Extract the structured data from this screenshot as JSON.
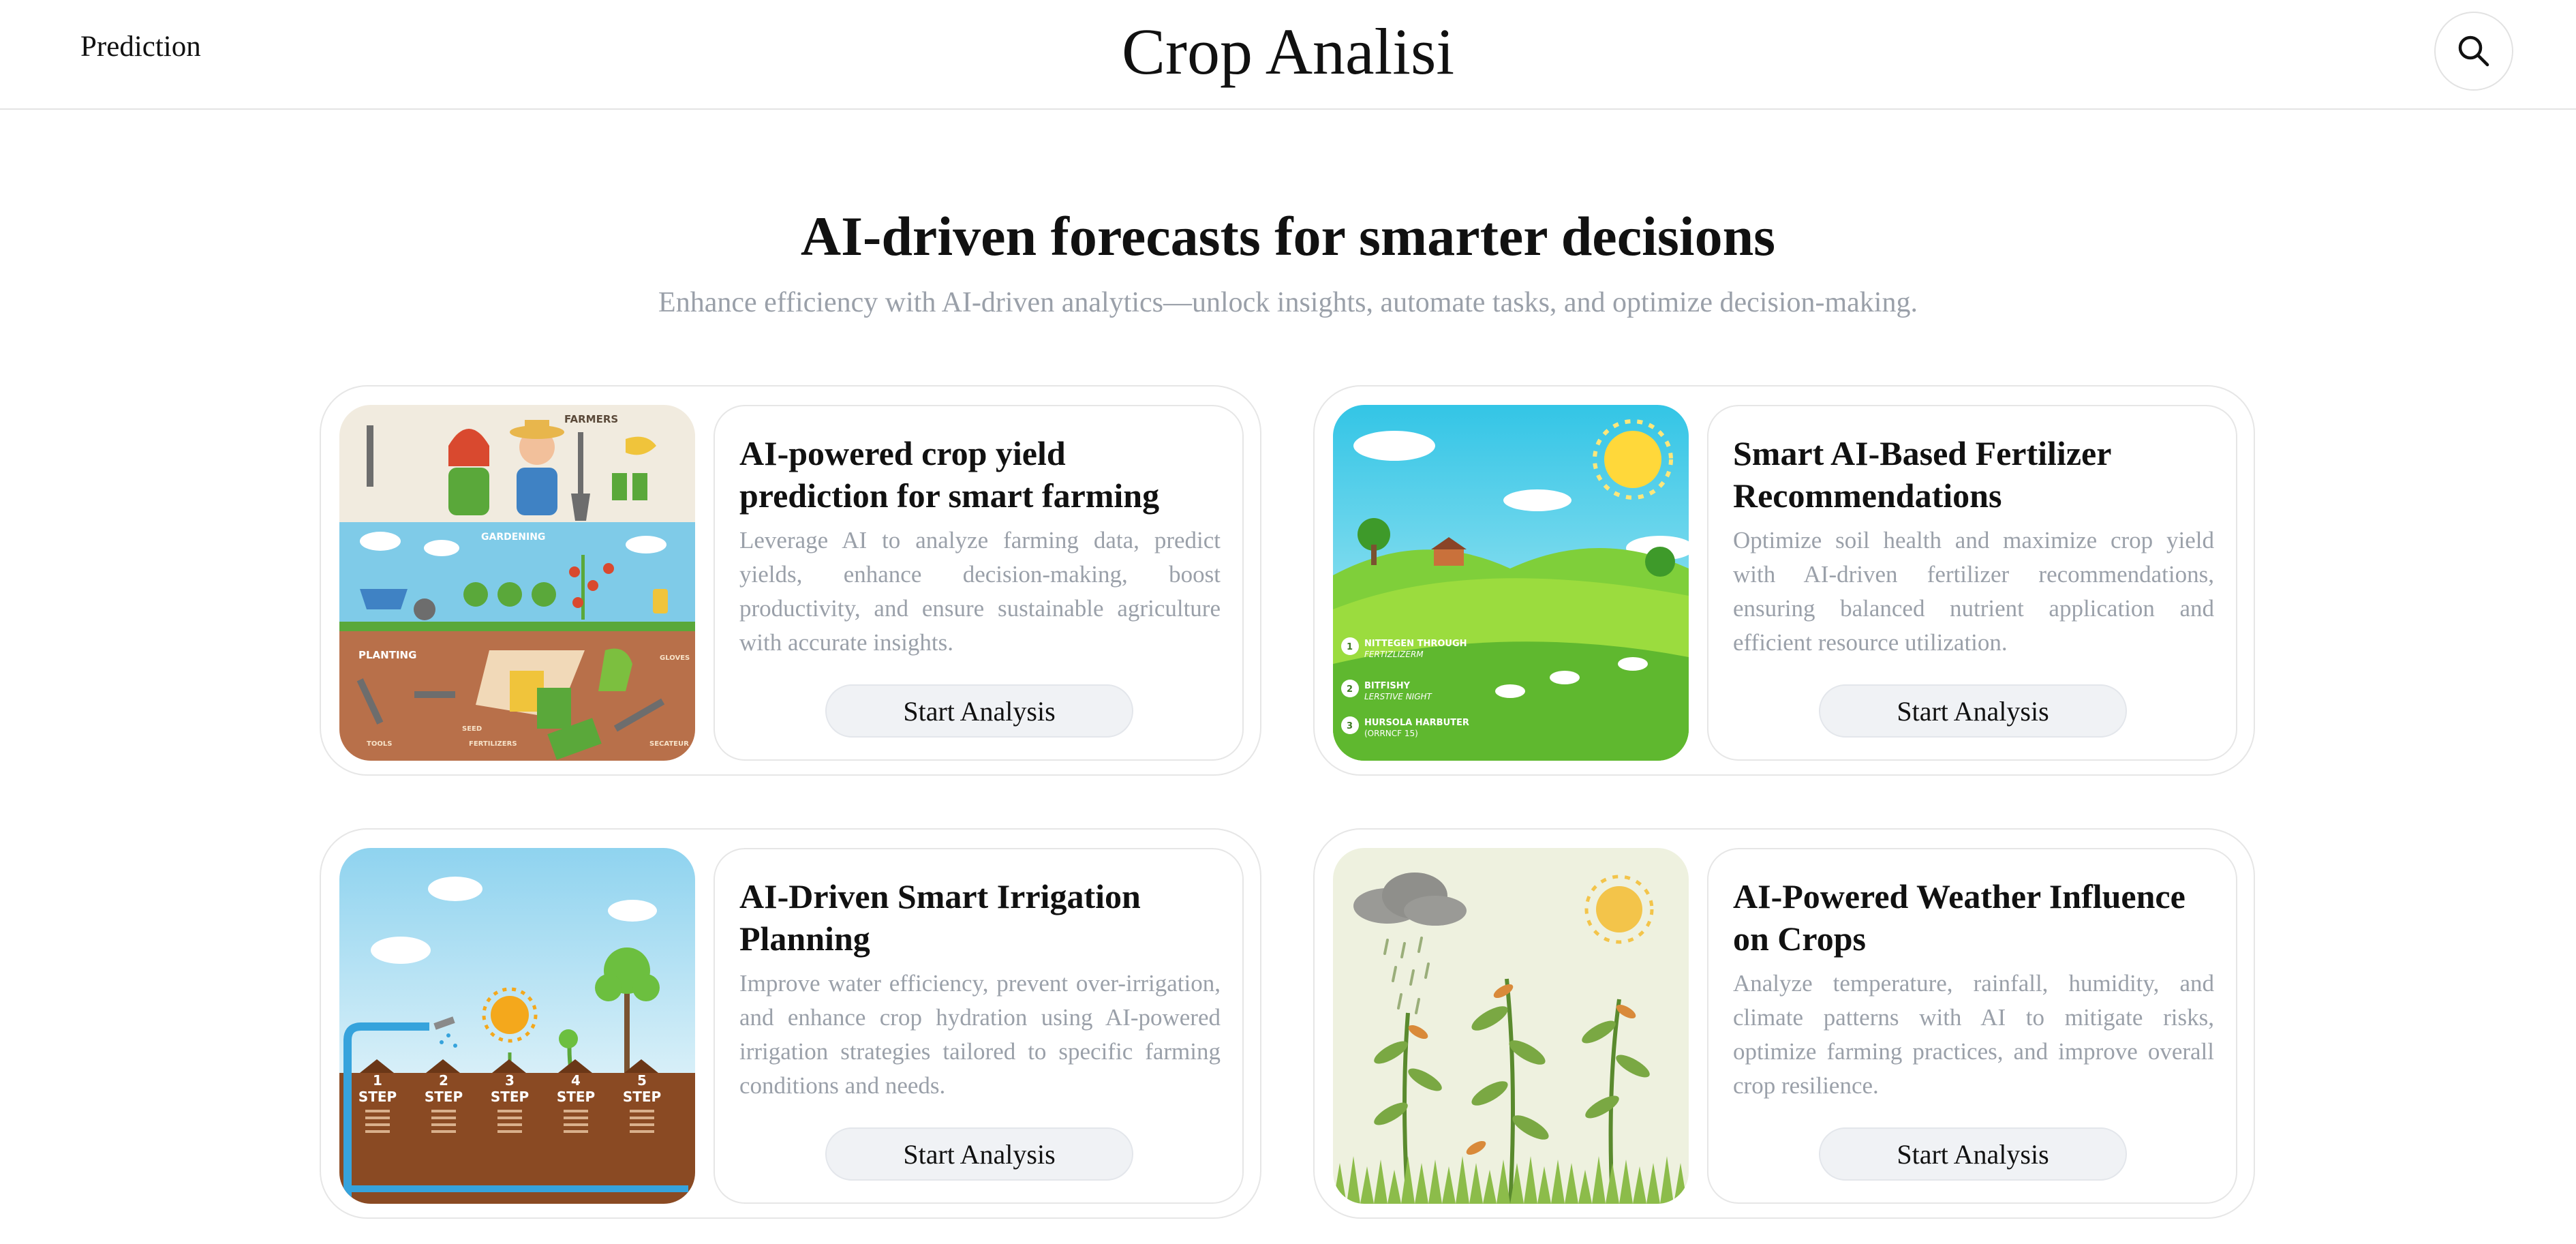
{
  "header": {
    "nav_link": "Prediction",
    "brand": "Crop Analisi"
  },
  "hero": {
    "title": "AI-driven forecasts for smarter decisions",
    "subtitle": "Enhance efficiency with AI-driven analytics—unlock insights, automate tasks, and optimize decision-making."
  },
  "cards": [
    {
      "title": "AI-powered crop yield prediction for smart farming",
      "description": "Leverage AI to analyze farming data, predict yields, enhance decision-making, boost productivity, and ensure sustainable agriculture with accurate insights.",
      "button": "Start Analysis",
      "image_labels": [
        "FARMERS",
        "GARDENING",
        "PLANTING",
        "GLOVES",
        "TOOLS",
        "SEED",
        "FERTILIZERS",
        "SECATEUR"
      ]
    },
    {
      "title": "Smart AI-Based Fertilizer Recommendations",
      "description": "Optimize soil health and maximize crop yield with AI-driven fertilizer recommendations, ensuring balanced nutrient application and efficient resource utilization.",
      "button": "Start Analysis",
      "image_labels": [
        "1",
        "NITTEGEN THROUGH",
        "FERTIZLIZERM",
        "2",
        "BITFISHY",
        "LERSTIVE NIGHT",
        "3",
        "HURSOLA HARBUTER",
        "(ORRNCF 15)"
      ]
    },
    {
      "title": "AI-Driven Smart Irrigation Planning",
      "description": "Improve water efficiency, prevent over-irrigation, and enhance crop hydration using AI-powered irrigation strategies tailored to specific farming conditions and needs.",
      "button": "Start Analysis",
      "image_labels": [
        "1",
        "STEP",
        "2",
        "STEP",
        "3",
        "STEP",
        "4",
        "STEP",
        "5",
        "STEP"
      ]
    },
    {
      "title": "AI-Powered Weather Influence on Crops",
      "description": "Analyze temperature, rainfall, humidity, and climate patterns with AI to mitigate risks, optimize farming practices, and improve overall crop resilience.",
      "button": "Start Analysis"
    }
  ],
  "icons": {
    "search": "search-icon"
  },
  "colors": {
    "muted_text": "#9aa0a9",
    "button_bg": "#f0f2f5",
    "border": "#e6e6e6"
  }
}
